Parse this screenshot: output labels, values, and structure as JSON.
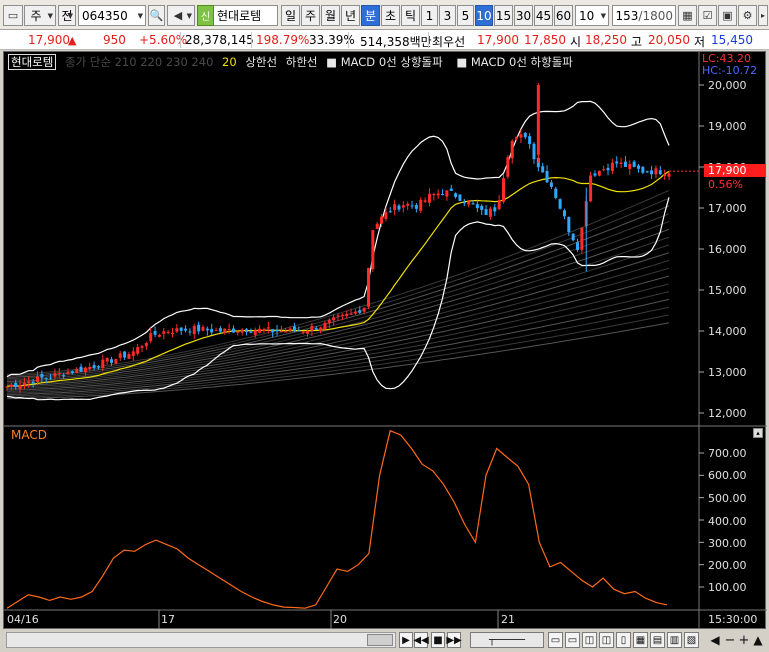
{
  "toolbar": {
    "market": "주",
    "scope": "전",
    "code": "064350",
    "badge": "신",
    "name": "현대로템",
    "periods": [
      "일",
      "주",
      "월",
      "년",
      "분",
      "초",
      "틱"
    ],
    "active_period": "분",
    "intervals": [
      "1",
      "3",
      "5",
      "10",
      "15",
      "30",
      "45",
      "60"
    ],
    "active_interval": "10",
    "interval_value": "10",
    "count": "153",
    "count_total": "/1800"
  },
  "quote": {
    "price": "17,900",
    "arrow": "▲",
    "change": "950",
    "change_pct": "+5.60%",
    "volume": "28,378,145",
    "vol_ratio": "198.79%",
    "turnover": "33.39%",
    "amount": "514,358백만",
    "preferred": "최우선",
    "ask": "17,900",
    "bid": "17,850",
    "open_label": "시",
    "open": "18,250",
    "high_label": "고",
    "high": "20,050",
    "low_label": "저",
    "low": "15,450"
  },
  "legend": {
    "name": "현대로템",
    "dim_text": "종가 단순 210  220  230  240",
    "ma20": "20",
    "upper": "상한선",
    "lower": "하한선",
    "macd_up": "MACD 0선 상향돌파",
    "macd_down": "MACD 0선 하향돌파"
  },
  "markers": {
    "lc": "LC:43.20",
    "hc": "HC:-10.72",
    "price_tag": "17,900",
    "price_pct": "0.56%"
  },
  "price_axis": [
    "20,000",
    "19,000",
    "18,000",
    "17,000",
    "16,000",
    "15,000",
    "14,000",
    "13,000",
    "12,000"
  ],
  "macd_axis": [
    "700.00",
    "600.00",
    "500.00",
    "400.00",
    "300.00",
    "200.00",
    "100.00"
  ],
  "macd_label": "MACD",
  "x_labels": [
    "04/16",
    "17",
    "20",
    "21"
  ],
  "time_label": "15:30:00",
  "colors": {
    "up": "#ff2a2a",
    "down": "#2fa8ff",
    "ma20": "#f0e000",
    "bands": "#ffffff",
    "macd": "#ff6a1a"
  },
  "chart_data": {
    "type": "line",
    "series": [
      {
        "name": "MACD",
        "values": [
          5,
          35,
          65,
          55,
          40,
          55,
          45,
          55,
          80,
          150,
          230,
          265,
          260,
          290,
          310,
          290,
          270,
          230,
          200,
          170,
          140,
          110,
          80,
          55,
          35,
          20,
          10,
          8,
          5,
          20,
          100,
          180,
          170,
          200,
          250,
          600,
          800,
          780,
          720,
          650,
          620,
          560,
          480,
          380,
          300,
          600,
          720,
          680,
          640,
          560,
          300,
          190,
          210,
          170,
          130,
          100,
          140,
          90,
          70,
          80,
          50,
          30,
          20
        ]
      }
    ],
    "ylim": [
      0,
      800
    ]
  }
}
